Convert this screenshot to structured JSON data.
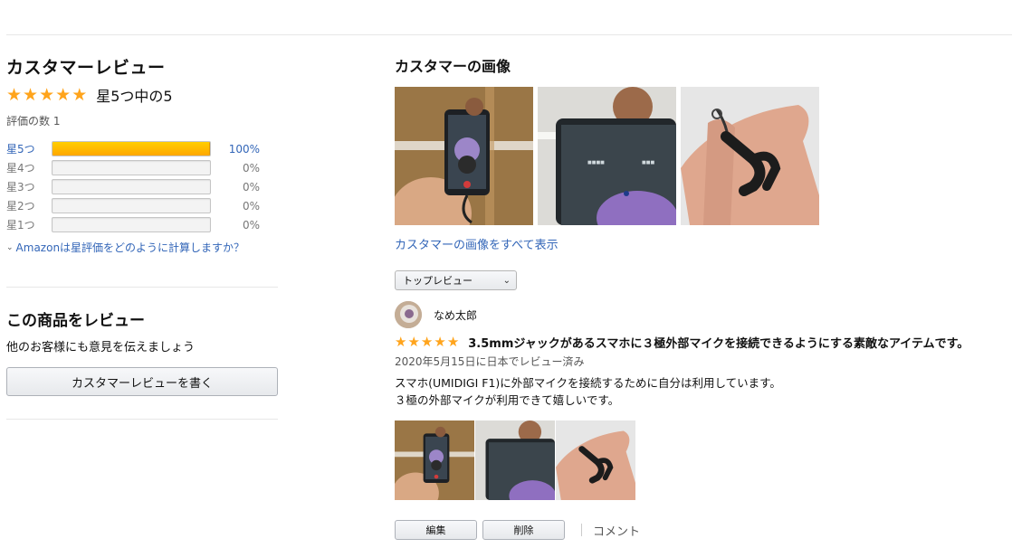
{
  "summary": {
    "heading": "カスタマーレビュー",
    "rating_text": "星5つ中の5",
    "stars": 5,
    "count_text": "評価の数 1"
  },
  "histogram": [
    {
      "label": "星5つ",
      "pct_text": "100%",
      "fraction": 1.0
    },
    {
      "label": "星4つ",
      "pct_text": "0%",
      "fraction": 0.0
    },
    {
      "label": "星3つ",
      "pct_text": "0%",
      "fraction": 0.0
    },
    {
      "label": "星2つ",
      "pct_text": "0%",
      "fraction": 0.0
    },
    {
      "label": "星1つ",
      "pct_text": "0%",
      "fraction": 0.0
    }
  ],
  "how_calc": "Amazonは星評価をどのように計算しますか？",
  "write_review": {
    "heading": "この商品をレビュー",
    "subtext": "他のお客様にも意見を伝えましょう",
    "button": "カスタマーレビューを書く"
  },
  "customer_images": {
    "heading": "カスタマーの画像",
    "see_all": "カスタマーの画像をすべて表示"
  },
  "sort": {
    "selected": "トップレビュー"
  },
  "review": {
    "reviewer": "なめ太郎",
    "stars": 5,
    "title": "3.5mmジャックがあるスマホに３極外部マイクを接続できるようにする素敵なアイテムです。",
    "date": "2020年5月15日に日本でレビュー済み",
    "body_line1": "スマホ(UMIDIGI F1)に外部マイクを接続するために自分は利用しています。",
    "body_line2": "３極の外部マイクが利用できて嬉しいです。",
    "edit_button": "編集",
    "delete_button": "削除",
    "comment": "コメント"
  },
  "colors": {
    "star": "#ffa41c",
    "link": "#3366b8",
    "bar_fill": "#ffa700"
  }
}
